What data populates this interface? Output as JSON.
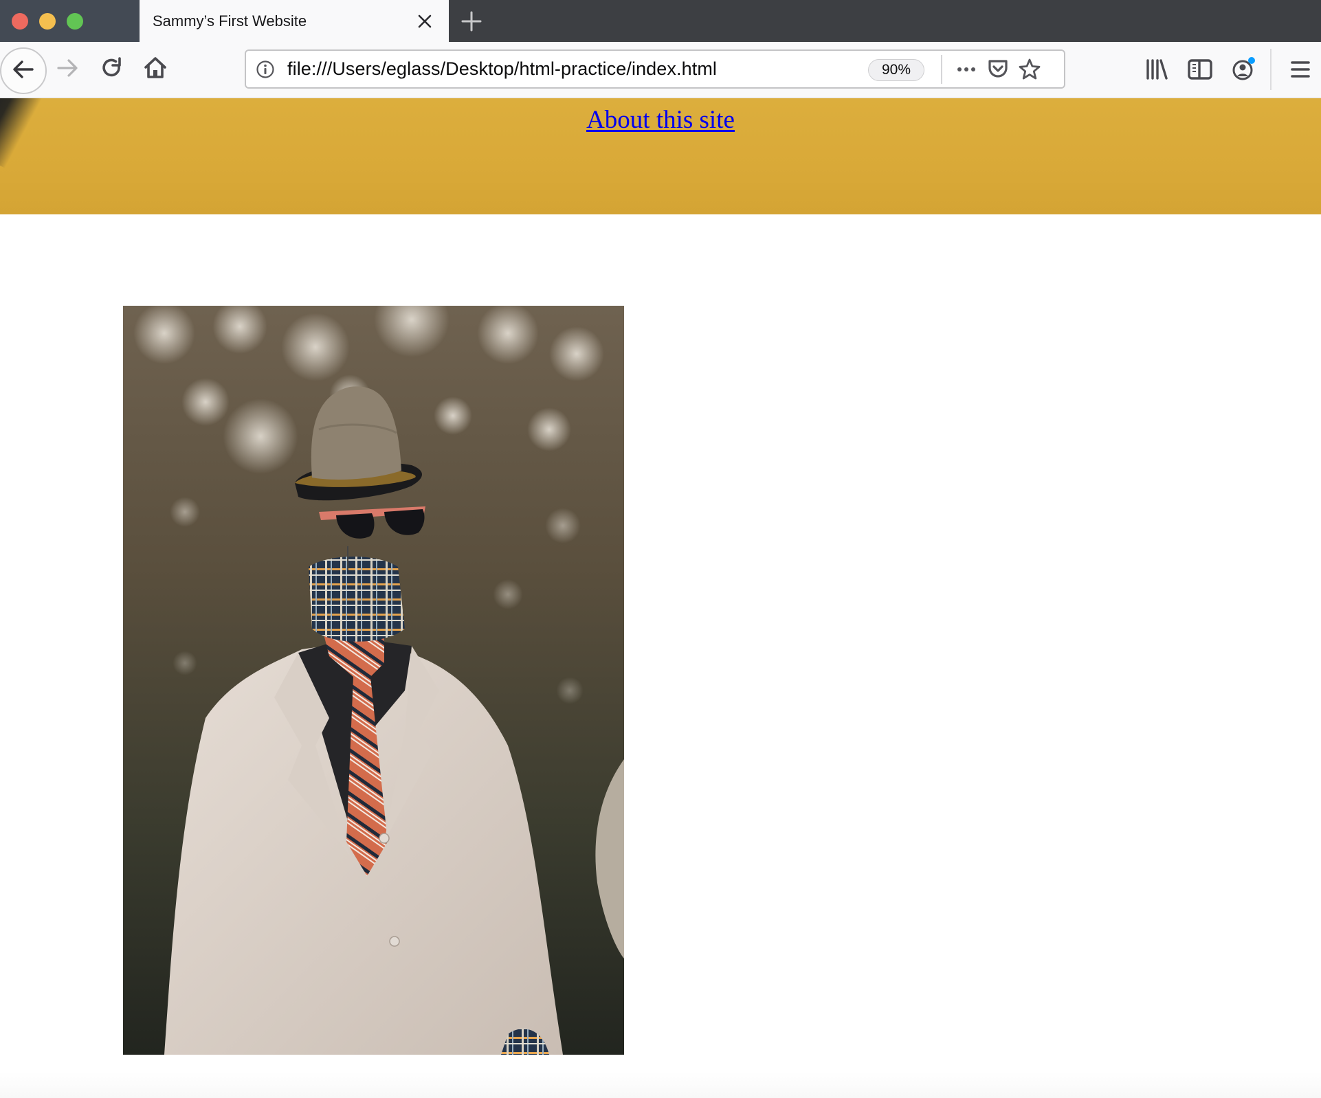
{
  "window": {
    "traffic_lights": [
      "close",
      "minimize",
      "zoom"
    ]
  },
  "tabs": [
    {
      "title": "Sammy’s First Website",
      "active": true,
      "close_icon": "close-icon"
    }
  ],
  "new_tab_icon": "plus-icon",
  "toolbar": {
    "back_icon": "arrow-left-icon",
    "forward_icon": "arrow-right-icon",
    "reload_icon": "reload-icon",
    "home_icon": "home-icon",
    "url": "file:///Users/eglass/Desktop/html-practice/index.html",
    "site_info_icon": "info-icon",
    "zoom_level": "90%",
    "page_actions_icon": "ellipsis-icon",
    "pocket_icon": "pocket-icon",
    "bookmark_icon": "star-icon",
    "library_icon": "library-icon",
    "sidebar_icon": "sidebar-icon",
    "account_icon": "account-icon",
    "account_badge_color": "#0a9dff",
    "menu_icon": "hamburger-menu-icon"
  },
  "page": {
    "header": {
      "link_text": "About this site",
      "background_color": "#d9aa3a",
      "link_color": "#0000ee"
    },
    "image": {
      "alt_description": "Headless mannequin in a beige suit with striped orange tie, plaid collar, sunglasses and a straw bowler hat in front of blurred trees"
    }
  }
}
